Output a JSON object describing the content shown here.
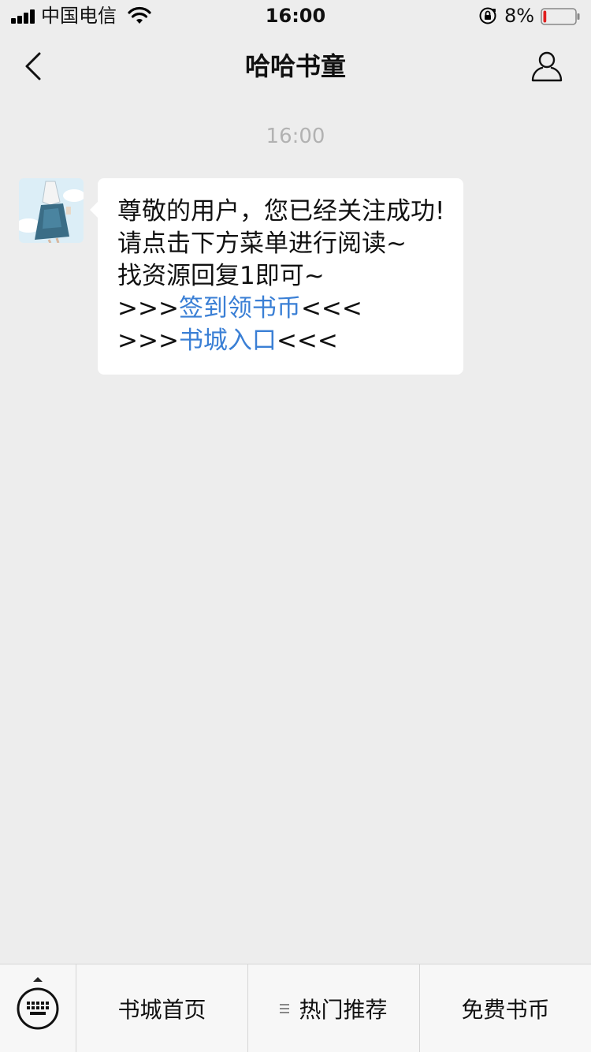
{
  "status_bar": {
    "carrier": "中国电信",
    "time": "16:00",
    "battery_percent": "8%",
    "battery_level": 0.08,
    "battery_color": "#e02020",
    "icons": [
      "signal-icon",
      "wifi-icon",
      "orientation-lock-icon",
      "battery-icon"
    ]
  },
  "nav": {
    "title": "哈哈书童",
    "back_icon": "chevron-left-icon",
    "profile_icon": "person-icon"
  },
  "chat": {
    "timestamp": "16:00",
    "message": {
      "line1": "尊敬的用户，您已经关注成功!",
      "line2": "请点击下方菜单进行阅读~",
      "line3": "找资源回复1即可~",
      "link1_prefix": ">>>",
      "link1_text": "签到领书币",
      "link1_suffix": "<<<",
      "link2_prefix": ">>>",
      "link2_text": "书城入口",
      "link2_suffix": "<<<"
    },
    "link_color": "#3a7fd5"
  },
  "menu": {
    "keyboard_icon": "keyboard-icon",
    "items": [
      {
        "label": "书城首页"
      },
      {
        "label": "热门推荐"
      },
      {
        "label": "免费书币"
      }
    ]
  }
}
